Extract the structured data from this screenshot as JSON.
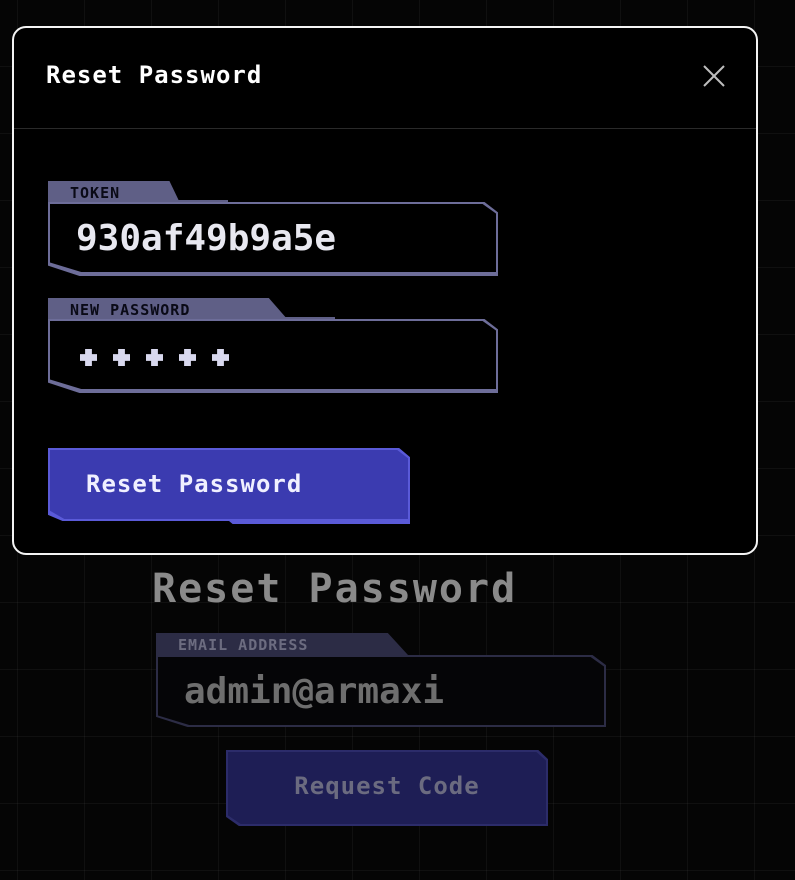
{
  "background_page": {
    "title": "Reset Password",
    "email_field": {
      "label": "EMAIL ADDRESS",
      "value": "admin@armaxi"
    },
    "request_button_label": "Request Code"
  },
  "modal": {
    "title": "Reset Password",
    "close_icon": "close-icon",
    "token_field": {
      "label": "TOKEN",
      "value": "930af49b9a5e"
    },
    "password_field": {
      "label": "NEW PASSWORD",
      "masked_length": 5
    },
    "submit_button_label": "Reset Password"
  },
  "colors": {
    "accent": "#3b3bb0",
    "accent_border": "#5a5ad8",
    "field_border": "#6d6d99",
    "modal_border": "#f4f4f4"
  }
}
